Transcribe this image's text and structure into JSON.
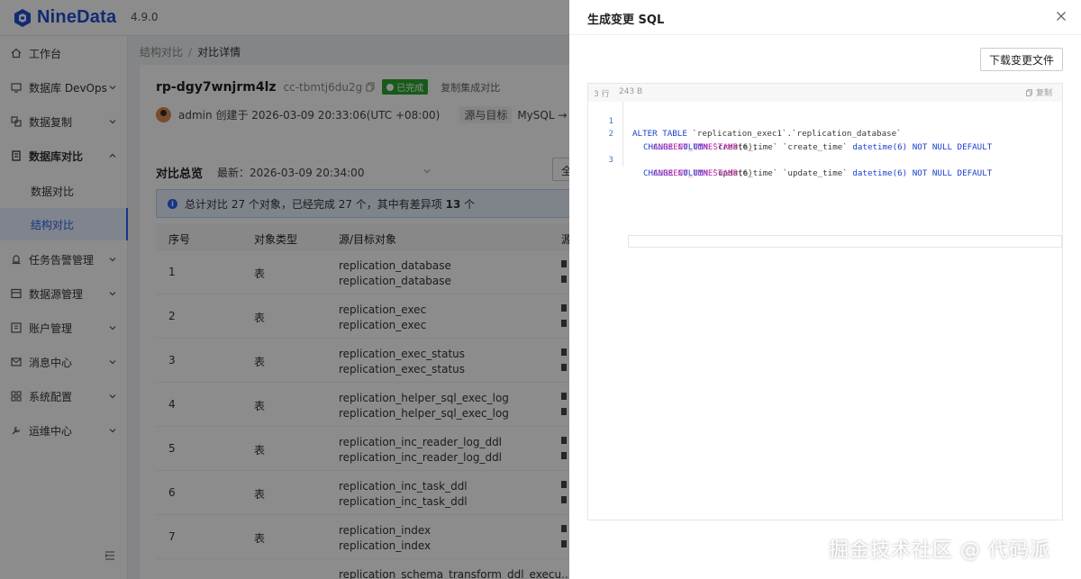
{
  "app": {
    "logo_text": "NineData",
    "version": "4.9.0"
  },
  "sidebar": {
    "items": [
      {
        "label": "工作台",
        "icon": "home-icon"
      },
      {
        "label": "数据库 DevOps",
        "icon": "devops-icon"
      },
      {
        "label": "数据复制",
        "icon": "replication-icon"
      },
      {
        "label": "数据库对比",
        "icon": "compare-icon"
      },
      {
        "label": "数据对比",
        "icon": ""
      },
      {
        "label": "结构对比",
        "icon": ""
      },
      {
        "label": "任务告警管理",
        "icon": "alarm-icon"
      },
      {
        "label": "数据源管理",
        "icon": "datasource-icon"
      },
      {
        "label": "账户管理",
        "icon": "account-icon"
      },
      {
        "label": "消息中心",
        "icon": "mail-icon"
      },
      {
        "label": "系统配置",
        "icon": "grid-icon"
      },
      {
        "label": "运维中心",
        "icon": "wrench-icon"
      }
    ]
  },
  "breadcrumb": {
    "parent": "结构对比",
    "separator": "/",
    "current": "对比详情"
  },
  "task": {
    "id": "rp-dgy7wnjrm4lz",
    "code": "cc-tbmtj6du2g",
    "status": "已完成",
    "copy_link": "复制集成对比",
    "creator": "admin",
    "created_text": "创建于 2026-03-09 20:33:06(UTC +08:00)",
    "src_tag": "源与目标",
    "db_flow": "MySQL → My"
  },
  "summary": {
    "title": "对比总览",
    "latest": "最新：2026-03-09 20:34:00",
    "filter_label": "全",
    "info": {
      "pre": "总计对比 27 个对象，已经完成 27 个，其中有差异项 ",
      "diff": "13",
      "post": " 个"
    }
  },
  "table": {
    "headers": [
      "序号",
      "对象类型",
      "源/目标对象",
      "源"
    ],
    "rows": [
      {
        "no": "1",
        "type": "表",
        "src": "replication_database",
        "dst": "replication_database"
      },
      {
        "no": "2",
        "type": "表",
        "src": "replication_exec",
        "dst": "replication_exec"
      },
      {
        "no": "3",
        "type": "表",
        "src": "replication_exec_status",
        "dst": "replication_exec_status"
      },
      {
        "no": "4",
        "type": "表",
        "src": "replication_helper_sql_exec_log",
        "dst": "replication_helper_sql_exec_log"
      },
      {
        "no": "5",
        "type": "表",
        "src": "replication_inc_reader_log_ddl",
        "dst": "replication_inc_reader_log_ddl"
      },
      {
        "no": "6",
        "type": "表",
        "src": "replication_inc_task_ddl",
        "dst": "replication_inc_task_ddl"
      },
      {
        "no": "7",
        "type": "表",
        "src": "replication_index",
        "dst": "replication_index"
      },
      {
        "no": "",
        "type": "",
        "src": "replication_schema_transform_ddl_execu...",
        "dst": ""
      }
    ]
  },
  "drawer": {
    "title": "生成变更 SQL",
    "download_label": "下载变更文件",
    "code_lines": "3 行",
    "code_size": "243 B",
    "copy_label": "复制"
  },
  "sql": {
    "l1": {
      "no": "1",
      "kw1": "ALTER TABLE",
      "rest": " `replication_exec1`.`replication_database`"
    },
    "l2": {
      "no": "2",
      "kw1": "CHANGE COLUMN",
      "mid": " `create_time` `create_time` ",
      "type": "datetime",
      "num": "(6)",
      "kw2": " NOT NULL DEFAULT"
    },
    "l2b": {
      "fn": "CURRENT_TIMESTAMP",
      "tail": "(6),"
    },
    "l3": {
      "no": "3",
      "kw1": "CHANGE COLUMN",
      "mid": " `update_time` `update_time` ",
      "type": "datetime",
      "num": "(6)",
      "kw2": " NOT NULL DEFAULT"
    },
    "l3b": {
      "fn": "CURRENT_TIMESTAMP",
      "tail": "(6)"
    }
  },
  "watermark": "掘金技术社区 @ 代码派",
  "colors": {
    "brand": "#1f4fd1",
    "accent": "#2a62f0",
    "success": "#2aa52f",
    "function": "#c322b0"
  }
}
